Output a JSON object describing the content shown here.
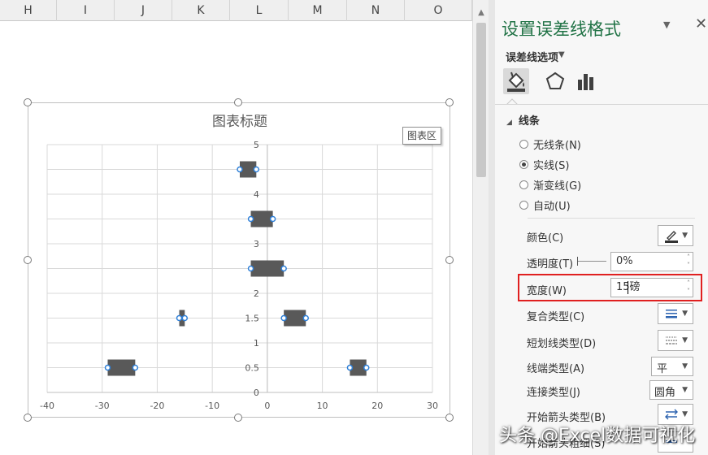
{
  "sheet": {
    "columns": [
      "H",
      "I",
      "J",
      "K",
      "L",
      "M",
      "N",
      "O"
    ]
  },
  "chart": {
    "title": "图表标题",
    "chart_area_tooltip": "图表区"
  },
  "chart_data": {
    "type": "scatter",
    "title": "图表标题",
    "xlabel": "",
    "ylabel": "",
    "xlim": [
      -40,
      30
    ],
    "ylim": [
      0,
      5
    ],
    "x_ticks": [
      -40,
      -30,
      -20,
      -10,
      0,
      10,
      20,
      30
    ],
    "y_ticks": [
      0,
      0.5,
      1,
      1.5,
      2,
      2.5,
      3,
      3.5,
      4,
      4.5,
      5
    ],
    "y_tick_labels": [
      "0",
      "0.5",
      "1",
      "1.5",
      "2",
      "",
      "3",
      "",
      "4",
      "",
      "5"
    ],
    "series_labels_on_axis": [
      "3"
    ],
    "grid": true,
    "error_bar_color": "#595959",
    "points": [
      {
        "x_left": -29,
        "x_right": -24,
        "y": 0.5
      },
      {
        "x_left": -16,
        "x_right": -15,
        "y": 1.5
      },
      {
        "x_left": -5,
        "x_right": -2,
        "y": 4.5
      },
      {
        "x_left": -3,
        "x_right": 3,
        "y": 2.5
      },
      {
        "x_left": -3,
        "x_right": 1,
        "y": 3.5
      },
      {
        "x_left": 3,
        "x_right": 7,
        "y": 1.5
      },
      {
        "x_left": 15,
        "x_right": 18,
        "y": 0.5
      }
    ]
  },
  "pane": {
    "title": "设置误差线格式",
    "options_label": "误差线选项",
    "section": "线条",
    "line_options": [
      {
        "label": "无线条(N)",
        "selected": false
      },
      {
        "label": "实线(S)",
        "selected": true
      },
      {
        "label": "渐变线(G)",
        "selected": false
      },
      {
        "label": "自动(U)",
        "selected": false
      }
    ],
    "props": {
      "color_label": "颜色(C)",
      "transparency_label": "透明度(T)",
      "transparency_value": "0%",
      "width_label": "宽度(W)",
      "width_value": "15磅",
      "compound_label": "复合类型(C)",
      "dash_label": "短划线类型(D)",
      "cap_label": "线端类型(A)",
      "cap_value": "平",
      "join_label": "连接类型(J)",
      "join_value": "圆角",
      "begin_arrow_label": "开始箭头类型(B)",
      "begin_arrow_size_label": "开始箭头粗细(S)"
    },
    "accent_color": "#217346"
  },
  "watermark": "头条 @Excel数据可视化"
}
